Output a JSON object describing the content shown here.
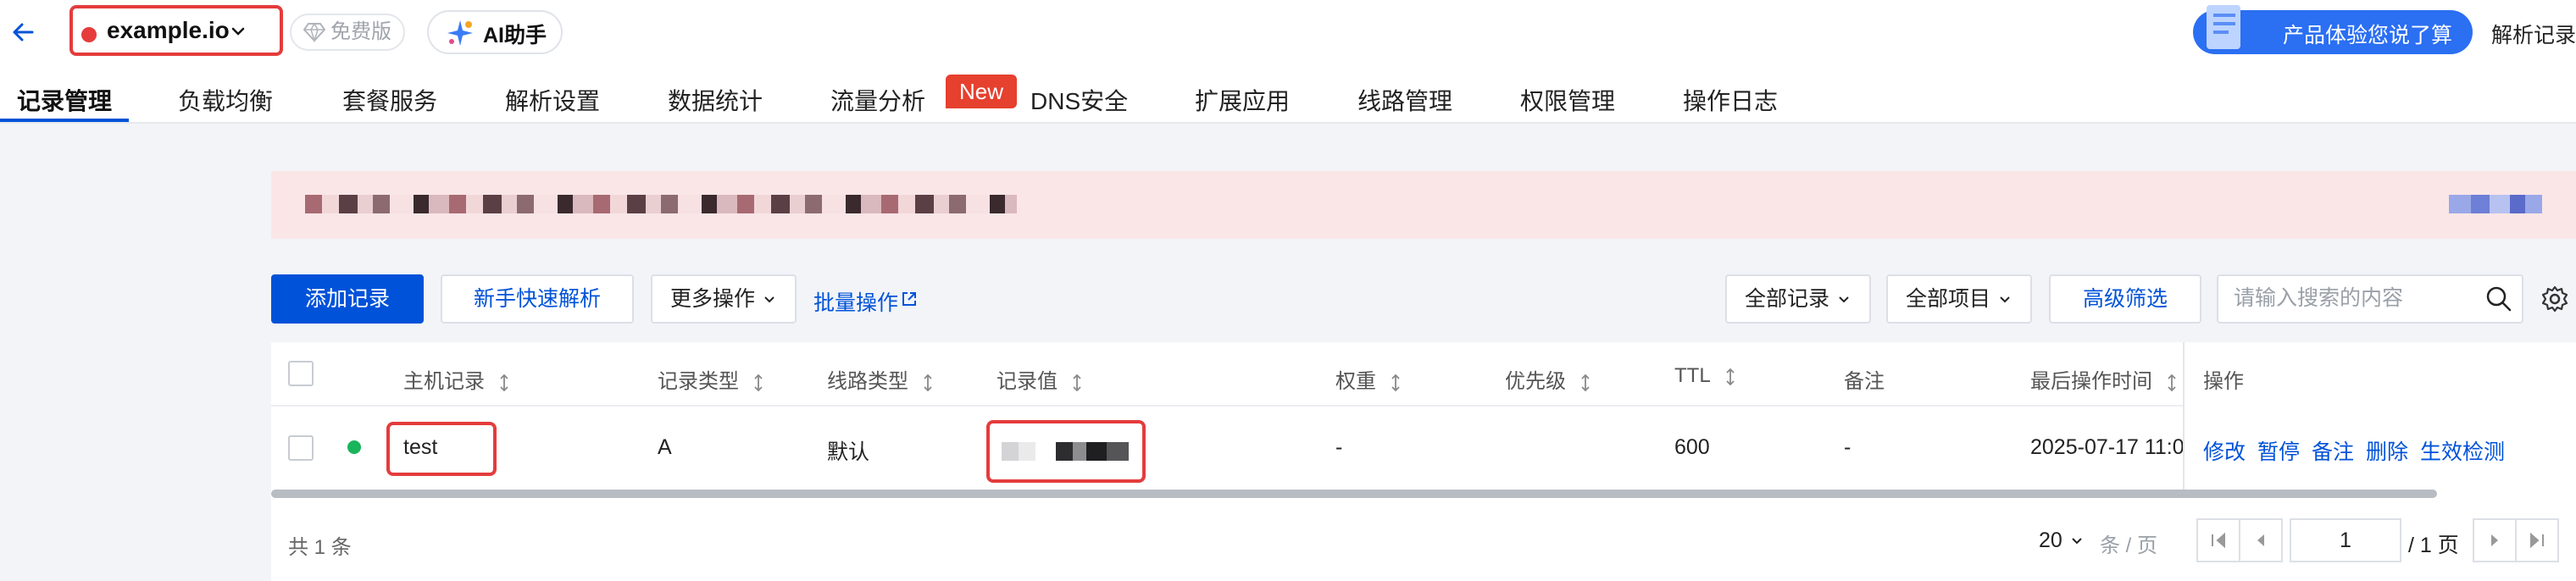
{
  "header": {
    "domain": "example.io",
    "plan_badge": "免费版",
    "ai_button": "AI助手",
    "promo_button": "产品体验您说了算",
    "right_link": "解析记录"
  },
  "tabs": [
    {
      "label": "记录管理",
      "active": true
    },
    {
      "label": "负载均衡"
    },
    {
      "label": "套餐服务"
    },
    {
      "label": "解析设置"
    },
    {
      "label": "数据统计"
    },
    {
      "label": "流量分析"
    },
    {
      "label": "DNS安全"
    },
    {
      "label": "扩展应用"
    },
    {
      "label": "线路管理"
    },
    {
      "label": "权限管理"
    },
    {
      "label": "操作日志"
    }
  ],
  "new_badge": "New",
  "toolbar": {
    "add_record": "添加记录",
    "quick_setup": "新手快速解析",
    "more_actions": "更多操作",
    "batch_ops": "批量操作",
    "all_records": "全部记录",
    "all_projects": "全部项目",
    "advanced_filter": "高级筛选",
    "search_placeholder": "请输入搜索的内容"
  },
  "table": {
    "columns": [
      "主机记录",
      "记录类型",
      "线路类型",
      "记录值",
      "权重",
      "优先级",
      "TTL",
      "备注",
      "最后操作时间",
      "操作"
    ],
    "rows": [
      {
        "host": "test",
        "type": "A",
        "line": "默认",
        "value": "",
        "weight": "-",
        "priority": "",
        "ttl": "600",
        "remark": "-",
        "updated": "2025-07-17 11:0",
        "actions": [
          "修改",
          "暂停",
          "备注",
          "删除",
          "生效检测"
        ]
      }
    ]
  },
  "footer": {
    "total": "共 1 条",
    "page_size": "20",
    "page_size_unit": "条 / 页",
    "current_page": "1",
    "total_pages": "/ 1 页"
  },
  "colors": {
    "primary": "#0052d9",
    "highlight": "#e43c3c",
    "banner_bg": "#fbe6e7",
    "status_ok": "#19b45b"
  }
}
